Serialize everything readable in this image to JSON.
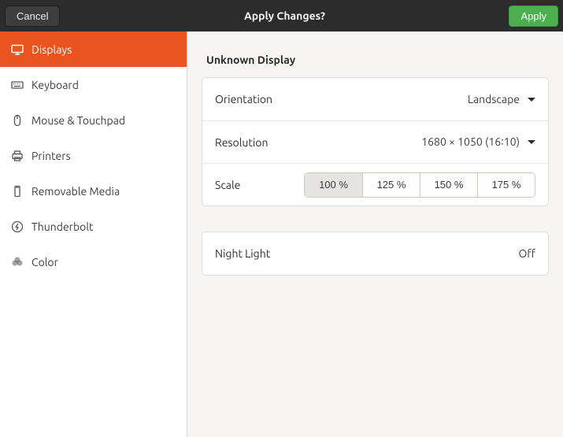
{
  "header": {
    "cancel_label": "Cancel",
    "title": "Apply Changes?",
    "apply_label": "Apply"
  },
  "sidebar": {
    "items": [
      {
        "id": "displays",
        "label": "Displays",
        "active": true
      },
      {
        "id": "keyboard",
        "label": "Keyboard",
        "active": false
      },
      {
        "id": "mouse",
        "label": "Mouse & Touchpad",
        "active": false
      },
      {
        "id": "printers",
        "label": "Printers",
        "active": false
      },
      {
        "id": "removable",
        "label": "Removable Media",
        "active": false
      },
      {
        "id": "thunderbolt",
        "label": "Thunderbolt",
        "active": false
      },
      {
        "id": "color",
        "label": "Color",
        "active": false
      }
    ]
  },
  "main": {
    "section_title": "Unknown Display",
    "orientation": {
      "label": "Orientation",
      "value": "Landscape"
    },
    "resolution": {
      "label": "Resolution",
      "value": "1680 × 1050 (16∶10)"
    },
    "scale": {
      "label": "Scale",
      "options": [
        "100 %",
        "125 %",
        "150 %",
        "175 %"
      ],
      "selected": "100 %"
    },
    "night_light": {
      "label": "Night Light",
      "value": "Off"
    }
  },
  "colors": {
    "accent": "#e95420",
    "apply": "#4caf50"
  }
}
